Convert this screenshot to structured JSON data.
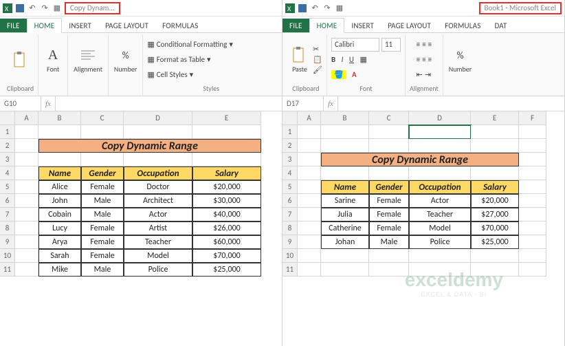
{
  "left": {
    "title": "Copy Dynam...",
    "tabs": {
      "file": "FILE",
      "home": "HOME",
      "insert": "INSERT",
      "page": "PAGE LAYOUT",
      "formulas": "FORMULAS"
    },
    "groups": {
      "clipboard": "Clipboard",
      "font": "Font",
      "alignment": "Alignment",
      "number": "Number",
      "styles": "Styles"
    },
    "styles_items": {
      "cond": "Conditional Formatting",
      "fmt": "Format as Table",
      "cell": "Cell Styles"
    },
    "namebox": "G10",
    "cols": [
      "A",
      "B",
      "C",
      "D",
      "E"
    ],
    "rows": [
      "1",
      "2",
      "3",
      "4",
      "5",
      "6",
      "7",
      "8",
      "9",
      "10",
      "11"
    ],
    "table_title": "Copy Dynamic Range",
    "headers": {
      "name": "Name",
      "gender": "Gender",
      "occ": "Occupation",
      "sal": "Salary"
    },
    "data": [
      {
        "name": "Alice",
        "gender": "Female",
        "occ": "Doctor",
        "sal": "$20,000"
      },
      {
        "name": "John",
        "gender": "Male",
        "occ": "Architect",
        "sal": "$30,000"
      },
      {
        "name": "Cobain",
        "gender": "Male",
        "occ": "Actor",
        "sal": "$40,000"
      },
      {
        "name": "Lucy",
        "gender": "Female",
        "occ": "Artist",
        "sal": "$26,000"
      },
      {
        "name": "Arya",
        "gender": "Female",
        "occ": "Teacher",
        "sal": "$60,000"
      },
      {
        "name": "Sarah",
        "gender": "Female",
        "occ": "Model",
        "sal": "$70,000"
      },
      {
        "name": "Mike",
        "gender": "Male",
        "occ": "Police",
        "sal": "$25,000"
      }
    ]
  },
  "right": {
    "title": "Book1 - Microsoft Excel",
    "tabs": {
      "file": "FILE",
      "home": "HOME",
      "insert": "INSERT",
      "page": "PAGE LAYOUT",
      "formulas": "FORMULAS",
      "dat": "DAT"
    },
    "groups": {
      "clipboard": "Clipboard",
      "font": "Font",
      "alignment": "Alignment",
      "number": "Number"
    },
    "font_name": "Calibri",
    "font_size": "11",
    "namebox": "D17",
    "cols": [
      "A",
      "B",
      "C",
      "D",
      "E",
      "F"
    ],
    "rows": [
      "1",
      "2",
      "3",
      "4",
      "5",
      "6",
      "7",
      "8",
      "9",
      "10",
      "11"
    ],
    "table_title": "Copy Dynamic Range",
    "headers": {
      "name": "Name",
      "gender": "Gender",
      "occ": "Occupation",
      "sal": "Salary"
    },
    "data": [
      {
        "name": "Sarine",
        "gender": "Female",
        "occ": "Actor",
        "sal": "$20,000"
      },
      {
        "name": "Julia",
        "gender": "Female",
        "occ": "Teacher",
        "sal": "$27,000"
      },
      {
        "name": "Catherine",
        "gender": "Female",
        "occ": "Model",
        "sal": "$70,000"
      },
      {
        "name": "Johan",
        "gender": "Male",
        "occ": "Police",
        "sal": "$25,000"
      }
    ]
  },
  "fx": "fx",
  "watermark": {
    "w1": "exceldemy",
    "w2": "EXCEL & DATA · BI"
  }
}
